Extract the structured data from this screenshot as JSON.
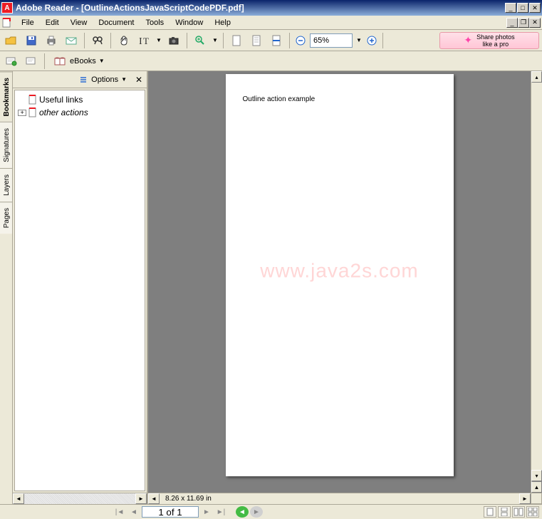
{
  "app": {
    "name": "Adobe Reader",
    "document_name": "[OutlineActionsJavaScriptCodePDF.pdf]"
  },
  "menu": {
    "items": [
      "File",
      "Edit",
      "View",
      "Document",
      "Tools",
      "Window",
      "Help"
    ]
  },
  "toolbar": {
    "zoom_value": "65%",
    "ebooks_label": "eBooks",
    "share_label_line1": "Share photos",
    "share_label_line2": "like a pro"
  },
  "side_tabs": [
    "Bookmarks",
    "Signatures",
    "Layers",
    "Pages"
  ],
  "bookmarks": {
    "options_label": "Options",
    "items": [
      {
        "label": "Useful links",
        "expandable": false,
        "italic": false
      },
      {
        "label": "other actions",
        "expandable": true,
        "italic": true
      }
    ]
  },
  "page": {
    "content_line": "Outline action example",
    "watermark": "www.java2s.com",
    "dimensions": "8.26 x 11.69 in"
  },
  "status": {
    "page_indicator": "1 of 1"
  }
}
